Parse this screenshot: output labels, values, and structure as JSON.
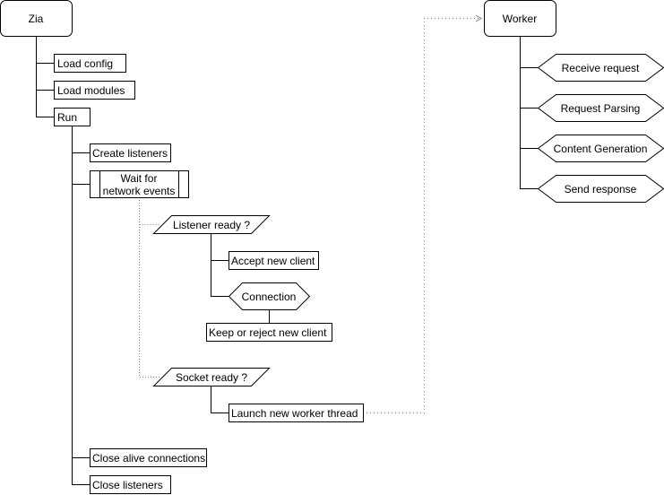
{
  "diagram": {
    "main": {
      "root": "Zia",
      "steps": [
        "Load config",
        "Load modules",
        "Run"
      ],
      "run_steps": {
        "create_listeners": "Create listeners",
        "wait": "Wait for network events",
        "wait_line1": "Wait for",
        "wait_line2": "network events",
        "listener_ready": "Listener ready ?",
        "accept_client": "Accept new client",
        "connection": "Connection",
        "keep_reject": "Keep or reject new client",
        "socket_ready": "Socket ready ?",
        "launch_worker": "Launch new worker thread",
        "close_connections": "Close alive connections",
        "close_listeners": "Close listeners"
      }
    },
    "worker": {
      "root": "Worker",
      "steps": [
        "Receive request",
        "Request Parsing",
        "Content Generation",
        "Send response"
      ]
    },
    "colors": {
      "stroke": "#000000",
      "dotted": "#808080",
      "fill": "#ffffff"
    }
  }
}
